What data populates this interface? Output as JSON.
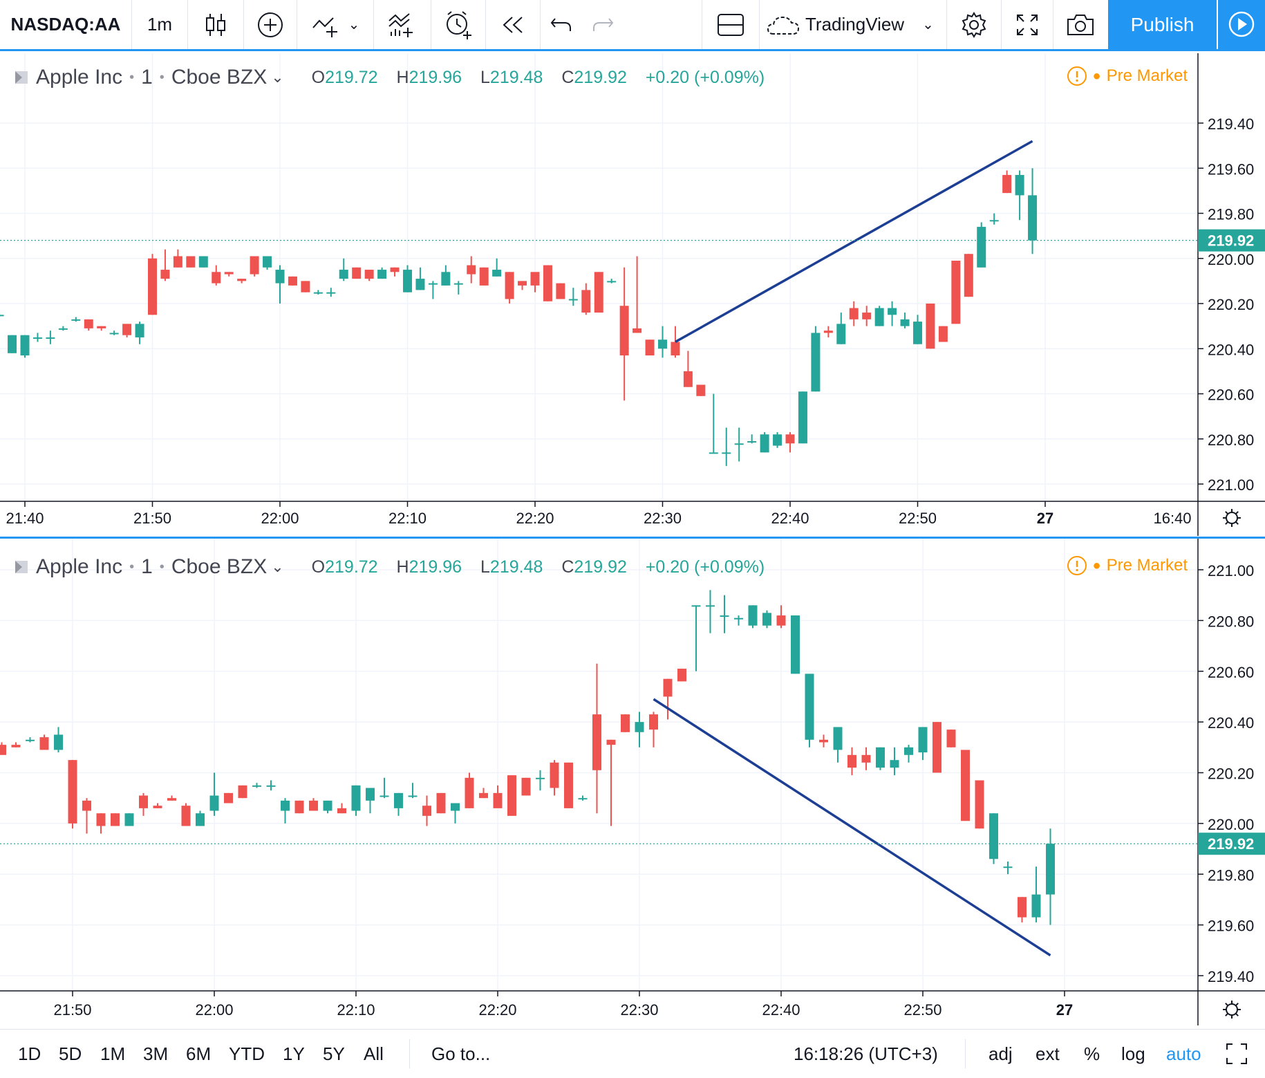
{
  "toolbar": {
    "symbol": "NASDAQ:AA",
    "interval": "1m",
    "layout_name": "TradingView",
    "publish_label": "Publish",
    "icons": [
      "candles-icon",
      "plus-circle-icon",
      "indicators-icon",
      "compare-icon",
      "alert-icon",
      "replay-icon",
      "undo-icon",
      "redo-icon",
      "layout-icon",
      "cloud-icon",
      "settings-icon",
      "fullscreen-icon",
      "camera-icon",
      "play-icon"
    ]
  },
  "legend": {
    "name": "Apple Inc",
    "interval": "1",
    "exchange": "Cboe BZX",
    "o_label": "O",
    "o_value": "219.72",
    "h_label": "H",
    "h_value": "219.96",
    "l_label": "L",
    "l_value": "219.48",
    "c_label": "C",
    "c_value": "219.92",
    "change": "+0.20 (+0.09%)",
    "pre_market": "Pre Market"
  },
  "colors": {
    "up": "#26a69a",
    "down": "#ef5350",
    "trendline": "#1c3f94",
    "accent": "#2196f3",
    "pre_market": "#ff9800"
  },
  "chart_data": [
    {
      "type": "candlestick",
      "title": "Apple Inc · 1 · Cboe BZX (inverted price scale)",
      "price_axis": {
        "inverted": true,
        "ticks": [
          "219.40",
          "219.60",
          "219.80",
          "220.00",
          "220.20",
          "220.40",
          "220.60",
          "220.80",
          "221.00"
        ],
        "last_price": "219.92",
        "range": [
          219.36,
          221.06
        ]
      },
      "time_axis": {
        "ticks": [
          "21:40",
          "21:50",
          "22:00",
          "22:10",
          "22:20",
          "22:30",
          "22:40",
          "22:50",
          "27",
          "16:40"
        ],
        "start": "21:38",
        "end": "23:01"
      },
      "candles": [
        {
          "t": "21:38",
          "o": 220.25,
          "h": 220.24,
          "l": 220.26,
          "c": 220.25
        },
        {
          "t": "21:39",
          "o": 220.34,
          "h": 220.34,
          "l": 220.42,
          "c": 220.42
        },
        {
          "t": "21:40",
          "o": 220.34,
          "h": 220.34,
          "l": 220.44,
          "c": 220.43
        },
        {
          "t": "21:41",
          "o": 220.35,
          "h": 220.33,
          "l": 220.37,
          "c": 220.35
        },
        {
          "t": "21:42",
          "o": 220.35,
          "h": 220.32,
          "l": 220.38,
          "c": 220.35
        },
        {
          "t": "21:43",
          "o": 220.31,
          "h": 220.3,
          "l": 220.32,
          "c": 220.31
        },
        {
          "t": "21:44",
          "o": 220.27,
          "h": 220.26,
          "l": 220.28,
          "c": 220.27
        },
        {
          "t": "21:45",
          "o": 220.31,
          "h": 220.3,
          "l": 220.32,
          "c": 220.27
        },
        {
          "t": "21:46",
          "o": 220.31,
          "h": 220.3,
          "l": 220.32,
          "c": 220.3
        },
        {
          "t": "21:47",
          "o": 220.33,
          "h": 220.32,
          "l": 220.34,
          "c": 220.33
        },
        {
          "t": "21:48",
          "o": 220.34,
          "h": 220.33,
          "l": 220.35,
          "c": 220.29
        },
        {
          "t": "21:49",
          "o": 220.29,
          "h": 220.28,
          "l": 220.38,
          "c": 220.35
        },
        {
          "t": "21:50",
          "o": 220.25,
          "h": 219.98,
          "l": 220.25,
          "c": 220.0
        },
        {
          "t": "21:51",
          "o": 220.09,
          "h": 219.96,
          "l": 220.1,
          "c": 220.05
        },
        {
          "t": "21:52",
          "o": 220.04,
          "h": 219.96,
          "l": 220.04,
          "c": 219.99
        },
        {
          "t": "21:53",
          "o": 220.04,
          "h": 219.99,
          "l": 220.04,
          "c": 219.99
        },
        {
          "t": "21:54",
          "o": 219.99,
          "h": 219.99,
          "l": 220.04,
          "c": 220.04
        },
        {
          "t": "21:55",
          "o": 220.11,
          "h": 220.03,
          "l": 220.12,
          "c": 220.06
        },
        {
          "t": "21:56",
          "o": 220.07,
          "h": 220.06,
          "l": 220.08,
          "c": 220.06
        },
        {
          "t": "21:57",
          "o": 220.1,
          "h": 220.09,
          "l": 220.11,
          "c": 220.09
        },
        {
          "t": "21:58",
          "o": 220.07,
          "h": 219.99,
          "l": 220.08,
          "c": 219.99
        },
        {
          "t": "21:59",
          "o": 219.99,
          "h": 219.99,
          "l": 220.05,
          "c": 220.04
        },
        {
          "t": "22:00",
          "o": 220.05,
          "h": 220.03,
          "l": 220.2,
          "c": 220.11
        },
        {
          "t": "22:01",
          "o": 220.12,
          "h": 220.08,
          "l": 220.12,
          "c": 220.08
        },
        {
          "t": "22:02",
          "o": 220.15,
          "h": 220.1,
          "l": 220.15,
          "c": 220.1
        },
        {
          "t": "22:03",
          "o": 220.15,
          "h": 220.14,
          "l": 220.16,
          "c": 220.15
        },
        {
          "t": "22:04",
          "o": 220.15,
          "h": 220.13,
          "l": 220.17,
          "c": 220.15
        },
        {
          "t": "22:05",
          "o": 220.05,
          "h": 220.0,
          "l": 220.1,
          "c": 220.09
        },
        {
          "t": "22:06",
          "o": 220.09,
          "h": 220.04,
          "l": 220.09,
          "c": 220.04
        },
        {
          "t": "22:07",
          "o": 220.09,
          "h": 220.08,
          "l": 220.1,
          "c": 220.05
        },
        {
          "t": "22:08",
          "o": 220.05,
          "h": 220.04,
          "l": 220.09,
          "c": 220.09
        },
        {
          "t": "22:09",
          "o": 220.06,
          "h": 220.04,
          "l": 220.08,
          "c": 220.04
        },
        {
          "t": "22:10",
          "o": 220.05,
          "h": 220.03,
          "l": 220.15,
          "c": 220.15
        },
        {
          "t": "22:11",
          "o": 220.09,
          "h": 220.04,
          "l": 220.14,
          "c": 220.14
        },
        {
          "t": "22:12",
          "o": 220.11,
          "h": 220.1,
          "l": 220.18,
          "c": 220.11
        },
        {
          "t": "22:13",
          "o": 220.06,
          "h": 220.03,
          "l": 220.12,
          "c": 220.12
        },
        {
          "t": "22:14",
          "o": 220.11,
          "h": 220.1,
          "l": 220.16,
          "c": 220.11
        },
        {
          "t": "22:15",
          "o": 220.07,
          "h": 219.99,
          "l": 220.11,
          "c": 220.03
        },
        {
          "t": "22:16",
          "o": 220.12,
          "h": 220.04,
          "l": 220.12,
          "c": 220.04
        },
        {
          "t": "22:17",
          "o": 220.05,
          "h": 220.0,
          "l": 220.08,
          "c": 220.08
        },
        {
          "t": "22:18",
          "o": 220.18,
          "h": 220.06,
          "l": 220.2,
          "c": 220.06
        },
        {
          "t": "22:19",
          "o": 220.12,
          "h": 220.1,
          "l": 220.14,
          "c": 220.1
        },
        {
          "t": "22:20",
          "o": 220.12,
          "h": 220.1,
          "l": 220.15,
          "c": 220.06
        },
        {
          "t": "22:21",
          "o": 220.19,
          "h": 220.03,
          "l": 220.19,
          "c": 220.03
        },
        {
          "t": "22:22",
          "o": 220.18,
          "h": 220.11,
          "l": 220.18,
          "c": 220.11
        },
        {
          "t": "22:23",
          "o": 220.18,
          "h": 220.13,
          "l": 220.21,
          "c": 220.18
        },
        {
          "t": "22:24",
          "o": 220.24,
          "h": 220.11,
          "l": 220.25,
          "c": 220.14
        },
        {
          "t": "22:25",
          "o": 220.24,
          "h": 220.06,
          "l": 220.24,
          "c": 220.06
        },
        {
          "t": "22:26",
          "o": 220.1,
          "h": 220.09,
          "l": 220.11,
          "c": 220.1
        },
        {
          "t": "22:27",
          "o": 220.43,
          "h": 220.04,
          "l": 220.63,
          "c": 220.21
        },
        {
          "t": "22:28",
          "o": 220.33,
          "h": 219.99,
          "l": 220.33,
          "c": 220.31
        },
        {
          "t": "22:29",
          "o": 220.43,
          "h": 220.36,
          "l": 220.43,
          "c": 220.36
        },
        {
          "t": "22:30",
          "o": 220.36,
          "h": 220.3,
          "l": 220.44,
          "c": 220.4
        },
        {
          "t": "22:31",
          "o": 220.43,
          "h": 220.3,
          "l": 220.44,
          "c": 220.37
        },
        {
          "t": "22:32",
          "o": 220.57,
          "h": 220.41,
          "l": 220.57,
          "c": 220.5
        },
        {
          "t": "22:33",
          "o": 220.61,
          "h": 220.56,
          "l": 220.61,
          "c": 220.56
        },
        {
          "t": "22:34",
          "o": 220.86,
          "h": 220.6,
          "l": 220.86,
          "c": 220.86
        },
        {
          "t": "22:35",
          "o": 220.86,
          "h": 220.75,
          "l": 220.92,
          "c": 220.86
        },
        {
          "t": "22:36",
          "o": 220.82,
          "h": 220.75,
          "l": 220.9,
          "c": 220.82
        },
        {
          "t": "22:37",
          "o": 220.81,
          "h": 220.78,
          "l": 220.82,
          "c": 220.81
        },
        {
          "t": "22:38",
          "o": 220.78,
          "h": 220.77,
          "l": 220.86,
          "c": 220.86
        },
        {
          "t": "22:39",
          "o": 220.78,
          "h": 220.77,
          "l": 220.84,
          "c": 220.83
        },
        {
          "t": "22:40",
          "o": 220.82,
          "h": 220.77,
          "l": 220.86,
          "c": 220.78
        },
        {
          "t": "22:41",
          "o": 220.59,
          "h": 220.59,
          "l": 220.82,
          "c": 220.82
        },
        {
          "t": "22:42",
          "o": 220.33,
          "h": 220.3,
          "l": 220.59,
          "c": 220.59
        },
        {
          "t": "22:43",
          "o": 220.33,
          "h": 220.3,
          "l": 220.35,
          "c": 220.32
        },
        {
          "t": "22:44",
          "o": 220.29,
          "h": 220.24,
          "l": 220.38,
          "c": 220.38
        },
        {
          "t": "22:45",
          "o": 220.27,
          "h": 220.19,
          "l": 220.3,
          "c": 220.22
        },
        {
          "t": "22:46",
          "o": 220.27,
          "h": 220.21,
          "l": 220.3,
          "c": 220.24
        },
        {
          "t": "22:47",
          "o": 220.22,
          "h": 220.21,
          "l": 220.3,
          "c": 220.3
        },
        {
          "t": "22:48",
          "o": 220.22,
          "h": 220.19,
          "l": 220.3,
          "c": 220.25
        },
        {
          "t": "22:49",
          "o": 220.27,
          "h": 220.24,
          "l": 220.31,
          "c": 220.3
        },
        {
          "t": "22:50",
          "o": 220.28,
          "h": 220.25,
          "l": 220.38,
          "c": 220.38
        },
        {
          "t": "22:51",
          "o": 220.4,
          "h": 220.2,
          "l": 220.4,
          "c": 220.2
        },
        {
          "t": "22:52",
          "o": 220.37,
          "h": 220.3,
          "l": 220.37,
          "c": 220.3
        },
        {
          "t": "22:53",
          "o": 220.29,
          "h": 220.01,
          "l": 220.29,
          "c": 220.01
        },
        {
          "t": "22:54",
          "o": 220.17,
          "h": 219.98,
          "l": 220.17,
          "c": 219.98
        },
        {
          "t": "22:55",
          "o": 219.86,
          "h": 219.84,
          "l": 220.04,
          "c": 220.04
        },
        {
          "t": "22:56",
          "o": 219.83,
          "h": 219.8,
          "l": 219.85,
          "c": 219.83
        },
        {
          "t": "22:57",
          "o": 219.71,
          "h": 219.61,
          "l": 219.71,
          "c": 219.63
        },
        {
          "t": "22:58",
          "o": 219.63,
          "h": 219.61,
          "l": 219.83,
          "c": 219.72
        },
        {
          "t": "22:59",
          "o": 219.72,
          "h": 219.6,
          "l": 219.98,
          "c": 219.92
        }
      ],
      "trendline": {
        "from": {
          "t": "22:31",
          "price": 220.37
        },
        "to": {
          "t": "22:59",
          "price": 219.48
        }
      }
    },
    {
      "type": "candlestick",
      "title": "Apple Inc · 1 · Cboe BZX",
      "price_axis": {
        "inverted": false,
        "ticks": [
          "219.40",
          "219.60",
          "219.80",
          "220.00",
          "220.20",
          "220.40",
          "220.60",
          "220.80",
          "221.00"
        ],
        "last_price": "219.92",
        "range": [
          219.36,
          221.06
        ]
      },
      "time_axis": {
        "ticks": [
          "21:50",
          "22:00",
          "22:10",
          "22:20",
          "22:30",
          "22:40",
          "22:50",
          "27"
        ],
        "start": "21:45",
        "end": "22:59.6"
      },
      "trendline": {
        "from": {
          "t": "22:31",
          "price": 220.49
        },
        "to": {
          "t": "22:59",
          "price": 219.48
        }
      }
    }
  ],
  "bottom": {
    "ranges": [
      "1D",
      "5D",
      "1M",
      "3M",
      "6M",
      "YTD",
      "1Y",
      "5Y",
      "All"
    ],
    "goto": "Go to...",
    "clock": "16:18:26 (UTC+3)",
    "adj": "adj",
    "ext": "ext",
    "percent": "%",
    "log": "log",
    "auto": "auto"
  }
}
